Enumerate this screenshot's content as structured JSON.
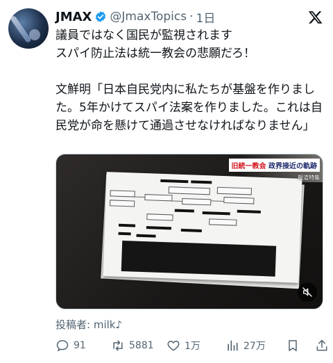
{
  "author": {
    "name": "JMAX",
    "handle": "@JmaxTopics",
    "separator": "·",
    "time": "1日"
  },
  "tweet": {
    "text": "議員ではなく国民が監視されます\nスパイ防止法は統一教会の悲願だろ！\n\n文鮮明「日本自民党内に私たちが基盤を作りました。5年かけてスパイ法案を作りました。これは自民党が命を懸けて通過させなければなりません」"
  },
  "media": {
    "banner_prefix": "旧統一教会",
    "banner_main": "政界接近の軌跡",
    "banner_sub": "報道特集"
  },
  "attribution": {
    "label": "投稿者: ",
    "user": "milk♪"
  },
  "actions": {
    "replies": "91",
    "retweets": "5881",
    "likes": "1万",
    "views": "27万"
  },
  "colors": {
    "verified": "#1d9bf0",
    "secondary_text": "#536471",
    "primary_text": "#0f1419"
  },
  "icons": [
    "verified-badge-icon",
    "x-logo-icon",
    "mute-icon",
    "reply-icon",
    "retweet-icon",
    "like-icon",
    "views-icon",
    "bookmark-icon",
    "share-icon"
  ]
}
